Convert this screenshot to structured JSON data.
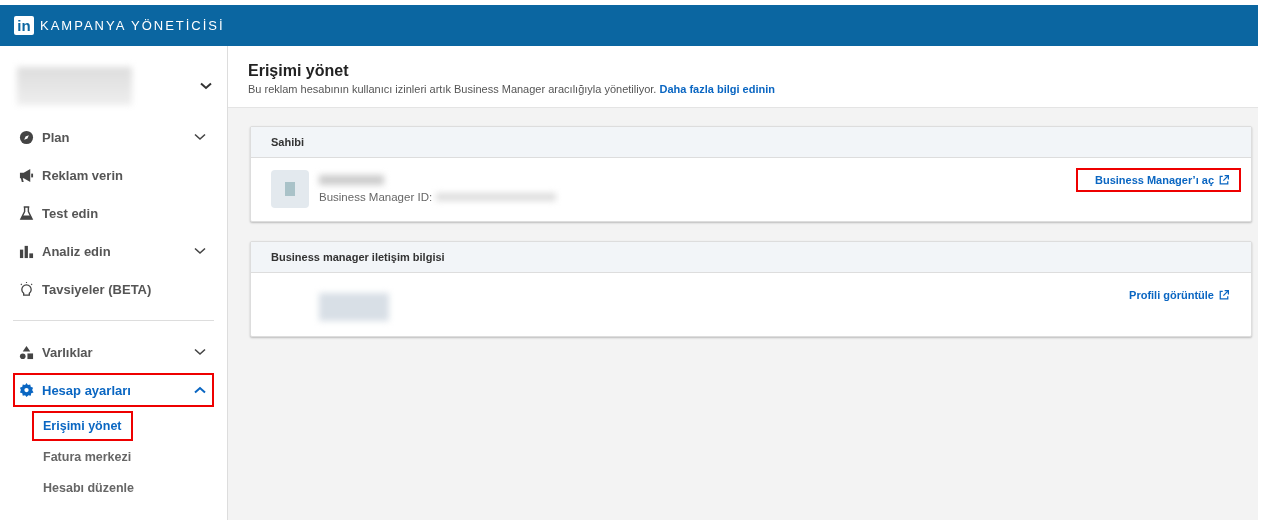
{
  "app": {
    "logo": "in",
    "title": "KAMPANYA YÖNETİCİSİ"
  },
  "sidebar": {
    "nav_groups": [
      [
        {
          "label": "Plan",
          "expanded": false
        },
        {
          "label": "Reklam verin"
        },
        {
          "label": "Test edin"
        },
        {
          "label": "Analiz edin",
          "expanded": false
        },
        {
          "label": "Tavsiyeler (BETA)"
        }
      ],
      [
        {
          "label": "Varlıklar",
          "expanded": false
        },
        {
          "label": "Hesap ayarları",
          "expanded": true,
          "selected": true,
          "highlighted": true,
          "children": [
            {
              "label": "Erişimi yönet",
              "selected": true,
              "highlighted": true
            },
            {
              "label": "Fatura merkezi",
              "selected": false,
              "highlighted": false
            },
            {
              "label": "Hesabı düzenle",
              "selected": false,
              "highlighted": false
            }
          ]
        }
      ]
    ]
  },
  "page": {
    "title": "Erişimi yönet",
    "description": "Bu reklam hesabının kullanıcı izinleri artık Business Manager aracılığıyla yönetiliyor.",
    "link": "Daha fazla bilgi edinin"
  },
  "cards": [
    {
      "title": "Sahibi",
      "kind": "owner",
      "id_label": "Business Manager ID:",
      "action": "Business Manager’ı aç",
      "highlighted": true
    },
    {
      "title": "Business manager iletişim bilgisi",
      "kind": "contact",
      "action": "Profili görüntüle",
      "highlighted": false
    }
  ]
}
